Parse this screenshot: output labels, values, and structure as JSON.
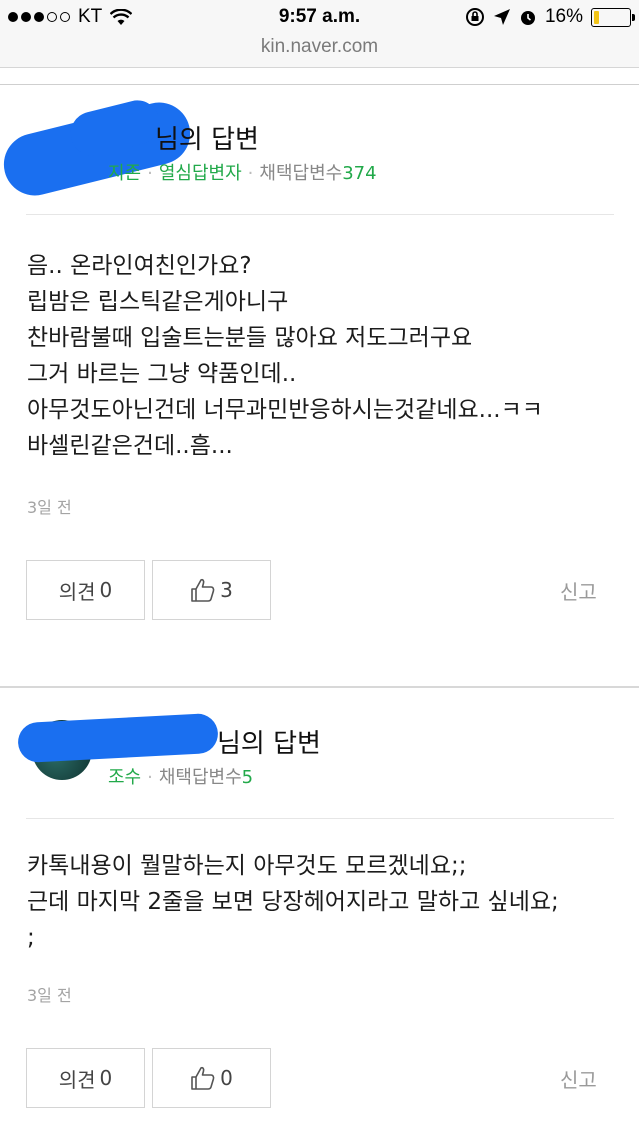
{
  "status_bar": {
    "carrier": "KT",
    "time": "9:57 a.m.",
    "battery": "16%",
    "battery_level": 0.16
  },
  "url": "kin.naver.com",
  "answers": [
    {
      "title": "님의 답변",
      "meta": {
        "rank": "지존",
        "badge": "열심답변자",
        "adopted_label": "채택답변수",
        "adopted_count": "374"
      },
      "body": "음.. 온라인여친인가요?\n립밤은 립스틱같은게아니구\n찬바람불때 입술트는분들 많아요 저도그러구요\n그거 바르는 그냥 약품인데..\n아무것도아닌건데 너무과민반응하시는것같네요...ㅋㅋ\n바셀린같은건데..흠...",
      "time": "3일 전",
      "opinion_label": "의견",
      "opinion_count": "0",
      "like_count": "3",
      "report_label": "신고"
    },
    {
      "title": "님의 답변",
      "meta": {
        "rank": "조수",
        "adopted_label": "채택답변수",
        "adopted_count": "5"
      },
      "body": "카톡내용이 뭘말하는지 아무것도 모르겠네요;;\n근데 마지막 2줄을 보면 당장헤어지라고 말하고 싶네요;\n;",
      "time": "3일 전",
      "opinion_label": "의견",
      "opinion_count": "0",
      "like_count": "0",
      "report_label": "신고"
    }
  ]
}
